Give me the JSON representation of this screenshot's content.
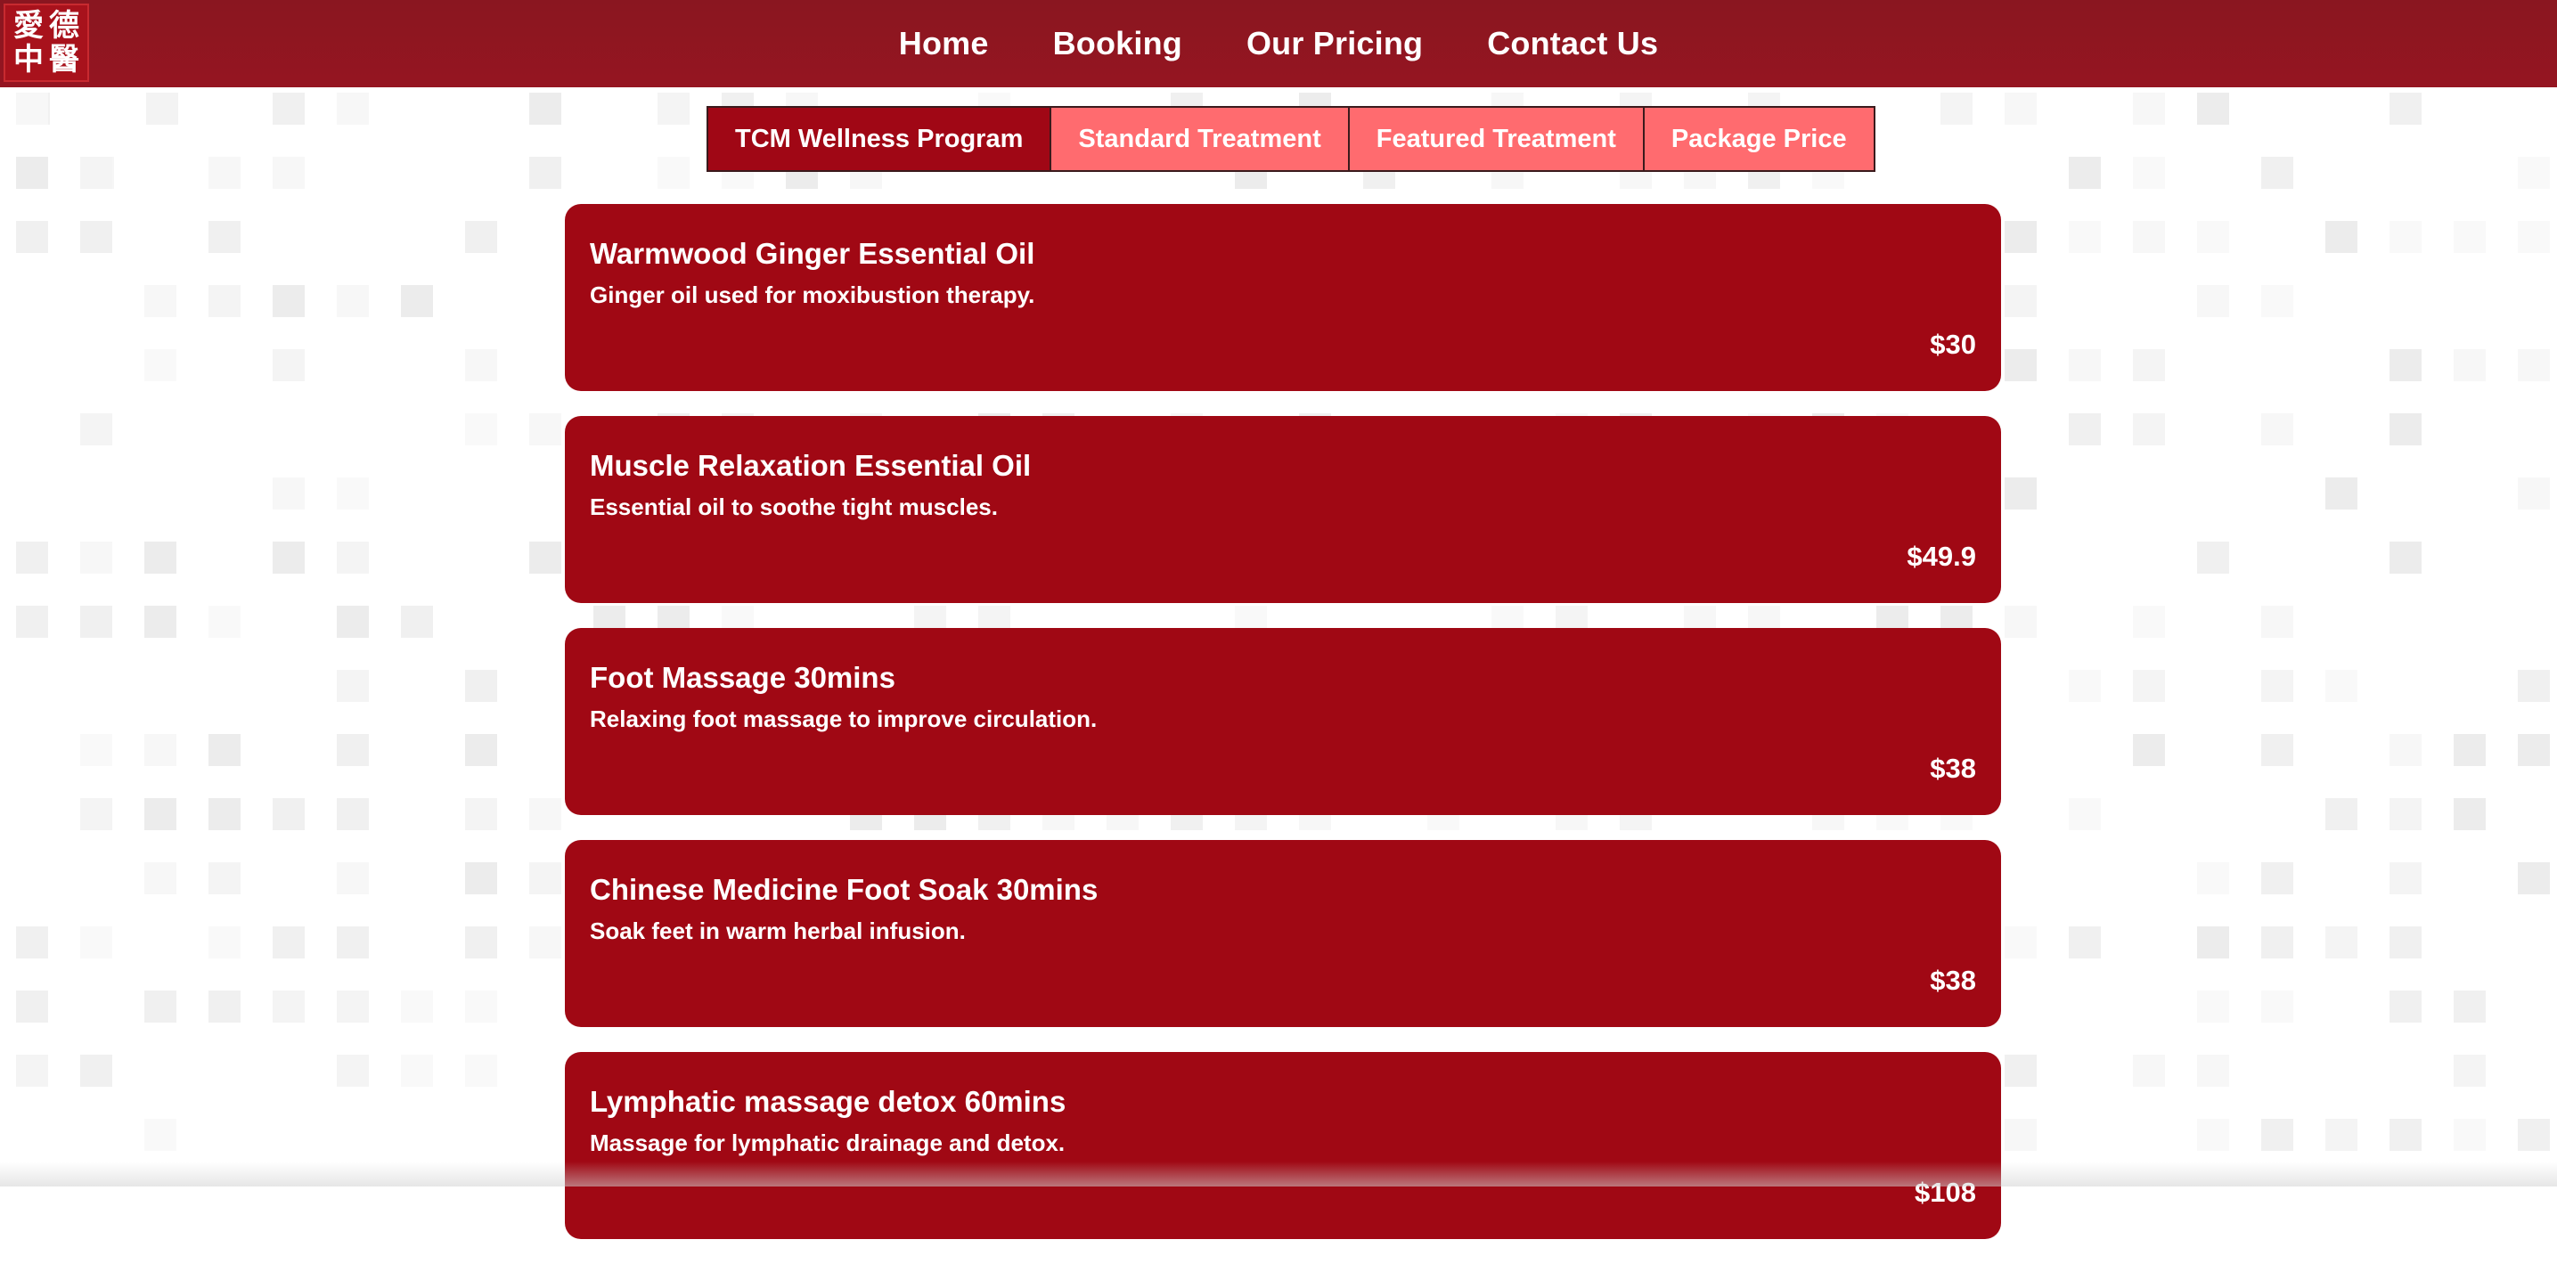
{
  "header": {
    "logo_chars": [
      "愛",
      "德",
      "中",
      "醫"
    ],
    "nav": [
      {
        "label": "Home"
      },
      {
        "label": "Booking"
      },
      {
        "label": "Our Pricing"
      },
      {
        "label": "Contact Us"
      }
    ]
  },
  "tabs": [
    {
      "label": "TCM Wellness Program",
      "active": true
    },
    {
      "label": "Standard Treatment",
      "active": false
    },
    {
      "label": "Featured Treatment",
      "active": false
    },
    {
      "label": "Package Price",
      "active": false
    }
  ],
  "items": [
    {
      "title": "Warmwood Ginger Essential Oil",
      "description": "Ginger oil used for moxibustion therapy.",
      "price": "$30"
    },
    {
      "title": "Muscle Relaxation Essential Oil",
      "description": "Essential oil to soothe tight muscles.",
      "price": "$49.9"
    },
    {
      "title": "Foot Massage 30mins",
      "description": "Relaxing foot massage to improve circulation.",
      "price": "$38"
    },
    {
      "title": "Chinese Medicine Foot Soak 30mins",
      "description": "Soak feet in warm herbal infusion.",
      "price": "$38"
    },
    {
      "title": "Lymphatic massage detox 60mins",
      "description": "Massage for lymphatic drainage and detox.",
      "price": "$108"
    }
  ],
  "colors": {
    "header": "#8f1620",
    "card": "#a00814",
    "tab_active": "#a00715",
    "tab_inactive": "#ff6b6f"
  }
}
